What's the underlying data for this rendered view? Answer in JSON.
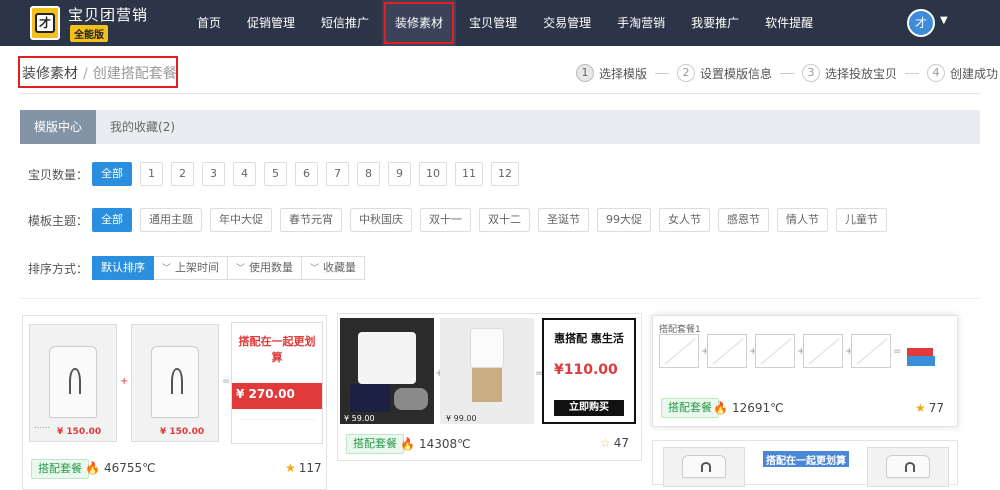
{
  "app": {
    "brand": "宝贝团营销",
    "edition": "全能版",
    "logo_glyph": "才",
    "avatar_glyph": "才"
  },
  "nav": {
    "items": [
      "首页",
      "促销管理",
      "短信推广",
      "装修素材",
      "宝贝管理",
      "交易管理",
      "手淘营销",
      "我要推广",
      "软件提醒"
    ],
    "active_index": 3
  },
  "breadcrumb": {
    "parent": "装修素材",
    "separator": "/",
    "current": "创建搭配套餐"
  },
  "steps": [
    {
      "num": "1",
      "label": "选择模版"
    },
    {
      "num": "2",
      "label": "设置模版信息"
    },
    {
      "num": "3",
      "label": "选择投放宝贝"
    },
    {
      "num": "4",
      "label": "创建成功"
    }
  ],
  "tabs": [
    {
      "label": "模版中心"
    },
    {
      "label": "我的收藏(2)"
    }
  ],
  "filters": {
    "count": {
      "label": "宝贝数量：",
      "options": [
        "全部",
        "1",
        "2",
        "3",
        "4",
        "5",
        "6",
        "7",
        "8",
        "9",
        "10",
        "11",
        "12"
      ]
    },
    "theme": {
      "label": "模板主题：",
      "options": [
        "全部",
        "通用主题",
        "年中大促",
        "春节元宵",
        "中秋国庆",
        "双十一",
        "双十二",
        "圣诞节",
        "99大促",
        "女人节",
        "感恩节",
        "情人节",
        "儿童节"
      ]
    },
    "sort": {
      "label": "排序方式：",
      "options": [
        "默认排序",
        "上架时间",
        "使用数量",
        "收藏量"
      ]
    }
  },
  "cards": [
    {
      "tag": "搭配套餐",
      "heat": "46755℃",
      "favorites": "117",
      "promo": "搭配在一起更划算",
      "price": "¥ 270.00",
      "item_price": "¥ 150.00"
    },
    {
      "tag": "搭配套餐",
      "heat": "14308℃",
      "favorites": "47",
      "promo": "惠搭配 惠生活",
      "price": "¥110.00",
      "buy": "立即购买",
      "left_price": "¥ 59.00",
      "right_price": "¥ 99.00"
    },
    {
      "tag": "搭配套餐",
      "heat": "12691℃",
      "favorites": "77",
      "title": "搭配套餐1"
    },
    {
      "promo": "搭配在一起更划算"
    }
  ]
}
